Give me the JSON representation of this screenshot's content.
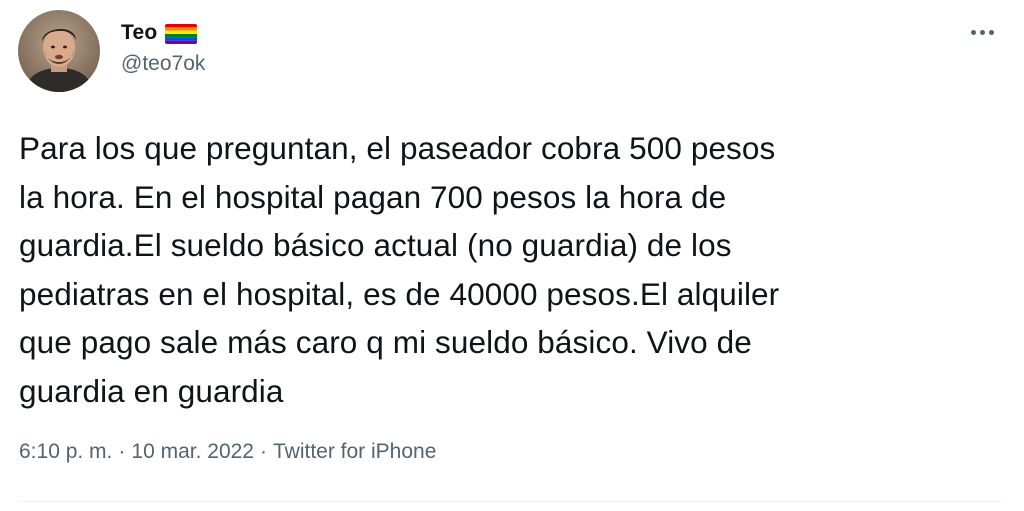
{
  "author": {
    "display_name": "Teo",
    "handle": "@teo7ok",
    "badge_icon": "rainbow-flag-icon",
    "avatar_icon": "avatar-photo"
  },
  "menu": {
    "icon": "more-options-icon"
  },
  "tweet": {
    "text_lines": [
      "Para los que preguntan, el paseador cobra 500 pesos",
      "la hora. En el hospital pagan 700 pesos la hora de",
      "guardia.El sueldo básico actual (no guardia) de los",
      "pediatras en el hospital, es de 40000 pesos.El alquiler",
      "que pago sale más caro q mi sueldo básico. Vivo de",
      "guardia en guardia"
    ],
    "time": "6:10 p. m.",
    "separator": "·",
    "date": "10 mar. 2022",
    "source": "Twitter for iPhone"
  },
  "colors": {
    "text": "#0f1419",
    "secondary": "#536471",
    "divider": "#eff3f4"
  }
}
